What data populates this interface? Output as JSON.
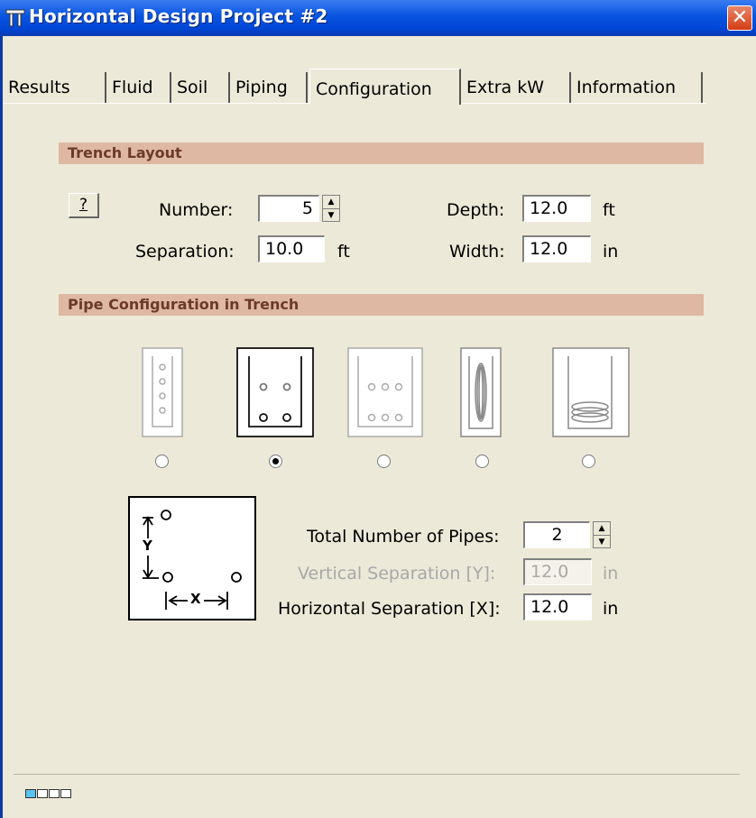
{
  "window": {
    "title": "Horizontal Design Project #2",
    "close_glyph": "✕"
  },
  "tabs": [
    {
      "label": "Results"
    },
    {
      "label": "Fluid"
    },
    {
      "label": "Soil"
    },
    {
      "label": "Piping"
    },
    {
      "label": "Configuration",
      "active": true
    },
    {
      "label": "Extra kW"
    },
    {
      "label": "Information"
    }
  ],
  "trench": {
    "header": "Trench Layout",
    "help_label": "?",
    "number_label": "Number:",
    "number_value": "5",
    "separation_label": "Separation:",
    "separation_value": "10.0",
    "separation_unit": "ft",
    "depth_label": "Depth:",
    "depth_value": "12.0",
    "depth_unit": "ft",
    "width_label": "Width:",
    "width_value": "12.0",
    "width_unit": "in"
  },
  "pipe_config": {
    "header": "Pipe Configuration in Trench",
    "selected_index": 1,
    "options": [
      "vertical-stack-4",
      "two-by-two",
      "three-by-two",
      "vertical-slinky",
      "horizontal-slinky"
    ]
  },
  "pipes": {
    "total_label": "Total Number of Pipes:",
    "total_value": "2",
    "vert_label": "Vertical Separation [Y]:",
    "vert_value": "12.0",
    "vert_unit": "in",
    "horiz_label": "Horizontal Separation [X]:",
    "horiz_value": "12.0",
    "horiz_unit": "in",
    "diagram_y": "Y",
    "diagram_x": "X"
  },
  "colors": {
    "section_header_bg": "#deb8a3",
    "section_header_text": "#6b3a28",
    "titlebar": "#0054e3"
  }
}
